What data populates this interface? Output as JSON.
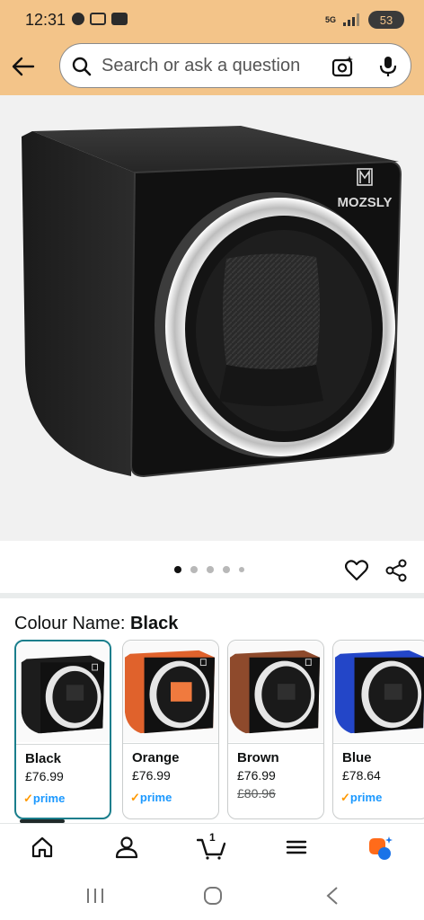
{
  "status_bar": {
    "time": "12:31",
    "network": "5G",
    "battery": "53"
  },
  "search": {
    "placeholder": "Search or ask a question"
  },
  "product": {
    "brand": "MOZSLY",
    "image_dots": {
      "count": 5,
      "active_index": 0
    }
  },
  "colour": {
    "label": "Colour Name:",
    "selected": "Black"
  },
  "variants": [
    {
      "name": "Black",
      "price": "£76.99",
      "old_price": "",
      "prime": "prime",
      "color": "#1c1c1c",
      "accent": "#1c1c1c"
    },
    {
      "name": "Orange",
      "price": "£76.99",
      "old_price": "",
      "prime": "prime",
      "color": "#e0622c",
      "accent": "#f07a3e"
    },
    {
      "name": "Brown",
      "price": "£76.99",
      "old_price": "£80.96",
      "prime": "prime",
      "color": "#8e4a2c",
      "accent": "#a65a38"
    },
    {
      "name": "Blue",
      "price": "£78.64",
      "old_price": "",
      "prime": "prime",
      "color": "#2346c8",
      "accent": "#3a5ee0"
    }
  ],
  "bottom_nav": {
    "cart_count": "1"
  },
  "colors": {
    "header_bg": "#f3c489",
    "selected_border": "#1a7e8c",
    "prime_blue": "#1a98ff",
    "alexa_orange": "#ff6b1a"
  }
}
